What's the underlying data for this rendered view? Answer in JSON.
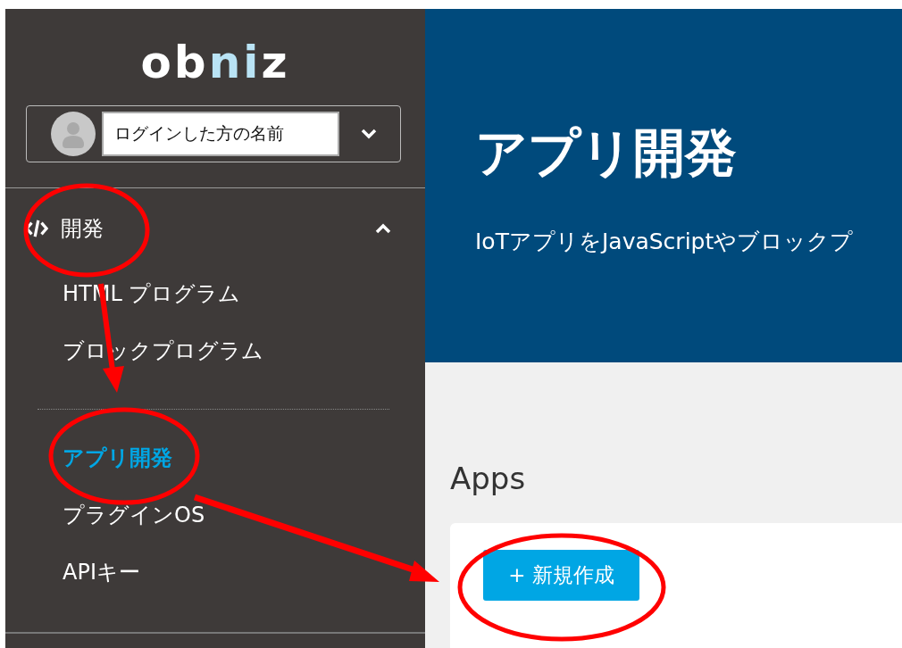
{
  "sidebar": {
    "logo": "obniz",
    "user": {
      "name": "ログインした方の名前"
    },
    "section": {
      "label": "開発",
      "expanded": true,
      "groups": [
        {
          "items": [
            {
              "label": "HTML プログラム",
              "selected": false
            },
            {
              "label": "ブロックプログラム",
              "selected": false
            }
          ]
        },
        {
          "items": [
            {
              "label": "アプリ開発",
              "selected": true
            },
            {
              "label": "プラグインOS",
              "selected": false
            },
            {
              "label": "APIキー",
              "selected": false
            }
          ]
        }
      ]
    }
  },
  "header": {
    "title": "アプリ開発",
    "subtitle": "IoTアプリをJavaScriptやブロックプ"
  },
  "apps": {
    "heading": "Apps",
    "new_button": "+ 新規作成"
  }
}
